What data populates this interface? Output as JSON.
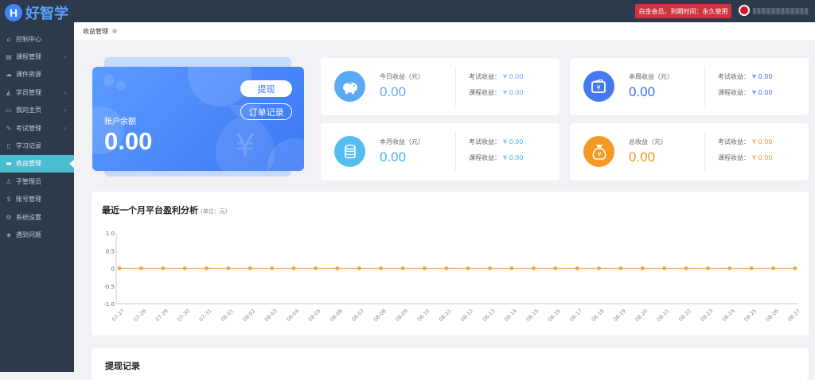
{
  "app": {
    "logo_letter": "H",
    "name": "好智学"
  },
  "header": {
    "vip_text": "白金会员，到期时间：永久使用"
  },
  "sidebar": {
    "items": [
      {
        "label": "控制中心",
        "icon": "home-icon",
        "glyph": "⌂",
        "arrow": false,
        "active": false
      },
      {
        "label": "课程管理",
        "icon": "book-icon",
        "glyph": "▤",
        "arrow": true,
        "active": false
      },
      {
        "label": "课件资源",
        "icon": "cloud-icon",
        "glyph": "☁",
        "arrow": false,
        "active": false
      },
      {
        "label": "学员管理",
        "icon": "graduation-cap-icon",
        "glyph": "◭",
        "arrow": true,
        "active": false
      },
      {
        "label": "我的主页",
        "icon": "window-icon",
        "glyph": "▭",
        "arrow": true,
        "active": false
      },
      {
        "label": "考试管理",
        "icon": "exam-icon",
        "glyph": "✎",
        "arrow": true,
        "active": false
      },
      {
        "label": "学习记录",
        "icon": "record-icon",
        "glyph": "▯",
        "arrow": false,
        "active": false
      },
      {
        "label": "收益管理",
        "icon": "credit-card-icon",
        "glyph": "▬",
        "arrow": false,
        "active": true
      },
      {
        "label": "子管理员",
        "icon": "user-icon",
        "glyph": "♙",
        "arrow": false,
        "active": false
      },
      {
        "label": "账号管理",
        "icon": "dollar-icon",
        "glyph": "$",
        "arrow": false,
        "active": false
      },
      {
        "label": "系统设置",
        "icon": "gear-icon",
        "glyph": "⚙",
        "arrow": false,
        "active": false
      },
      {
        "label": "遇到问题",
        "icon": "question-icon",
        "glyph": "◈",
        "arrow": false,
        "active": false
      }
    ]
  },
  "breadcrumb": {
    "current": "收益管理"
  },
  "balance": {
    "label": "账户余额",
    "value": "0.00",
    "withdraw_label": "提现",
    "orders_label": "订单记录",
    "currency_glyph": "¥"
  },
  "stats": {
    "today": {
      "title": "今日收益（元）",
      "value": "0.00",
      "exam_label": "考试收益：",
      "exam_value": "¥ 0.00",
      "course_label": "课程收益：",
      "course_value": "¥ 0.00",
      "color": "#6ea8f5",
      "icon_bg": "#5ba9f5",
      "icon": "piggy-bank-icon"
    },
    "week": {
      "title": "本周收益（元）",
      "value": "0.00",
      "exam_label": "考试收益：",
      "exam_value": "¥ 0.00",
      "course_label": "课程收益：",
      "course_value": "¥ 0.00",
      "color": "#3f6df0",
      "icon_bg": "#4779ee",
      "icon": "wallet-icon"
    },
    "month": {
      "title": "本月收益（元）",
      "value": "0.00",
      "exam_label": "考试收益：",
      "exam_value": "¥ 0.00",
      "course_label": "课程收益：",
      "course_value": "¥ 0.00",
      "color": "#44b7e8",
      "icon_bg": "#55bdf0",
      "icon": "coins-icon"
    },
    "total": {
      "title": "总收益（元）",
      "value": "0.00",
      "exam_label": "考试收益：",
      "exam_value": "¥ 0.00",
      "course_label": "课程收益：",
      "course_value": "¥ 0.00",
      "color": "#f39a1e",
      "icon_bg": "#f49a22",
      "icon": "money-bag-icon"
    }
  },
  "chart": {
    "title": "最近一个月平台盈利分析",
    "unit": "(单位：元)"
  },
  "chart_data": {
    "type": "line",
    "title": "最近一个月平台盈利分析",
    "subtitle": "(单位：元)",
    "categories": [
      "07-27",
      "07-28",
      "07-29",
      "07-30",
      "07-31",
      "08-01",
      "08-02",
      "08-03",
      "08-04",
      "08-05",
      "08-06",
      "08-07",
      "08-08",
      "08-09",
      "08-10",
      "08-11",
      "08-12",
      "08-13",
      "08-14",
      "08-15",
      "08-16",
      "08-17",
      "08-18",
      "08-19",
      "08-20",
      "08-21",
      "08-22",
      "08-23",
      "08-24",
      "08-25",
      "08-26",
      "08-27"
    ],
    "values": [
      0,
      0,
      0,
      0,
      0,
      0,
      0,
      0,
      0,
      0,
      0,
      0,
      0,
      0,
      0,
      0,
      0,
      0,
      0,
      0,
      0,
      0,
      0,
      0,
      0,
      0,
      0,
      0,
      0,
      0,
      0,
      0
    ],
    "yticks": [
      "1.0",
      "0.5",
      "0",
      "-0.5",
      "-1.0"
    ],
    "ylim": [
      -1,
      1
    ],
    "grid": false,
    "series_color": "#f5a442"
  },
  "withdraw_section": {
    "title": "提现记录"
  }
}
